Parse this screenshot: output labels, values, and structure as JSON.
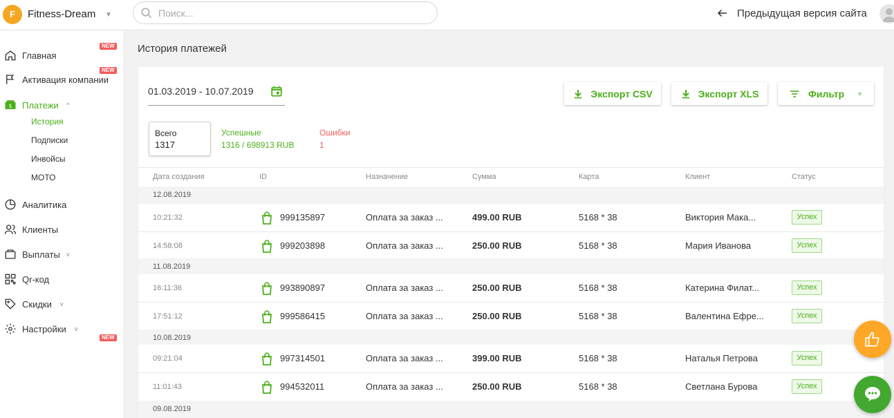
{
  "header": {
    "logo_letter": "F",
    "brand": "Fitness-Dream",
    "search_placeholder": "Поиск...",
    "back_link": "Предыдущая версия сайта"
  },
  "sidebar": {
    "items": [
      {
        "label": "Главная",
        "icon": "home-icon",
        "badge": "NEW"
      },
      {
        "label": "Активация компании",
        "icon": "flag-icon",
        "badge": "NEW"
      },
      {
        "label": "Платежи",
        "icon": "payments-icon",
        "active": true
      },
      {
        "label": "Аналитика",
        "icon": "pie-chart-icon"
      },
      {
        "label": "Клиенты",
        "icon": "users-icon"
      },
      {
        "label": "Выплаты",
        "icon": "wallet-icon"
      },
      {
        "label": "Qr-код",
        "icon": "qr-code-icon"
      },
      {
        "label": "Скидки",
        "icon": "tag-icon"
      },
      {
        "label": "Настройки",
        "icon": "gear-icon",
        "badge": "NEW"
      }
    ],
    "subitems": [
      "История",
      "Подписки",
      "Инвойсы",
      "МОТО"
    ]
  },
  "page": {
    "title": "История платежей",
    "date_range": "01.03.2019 - 10.07.2019",
    "export_csv": "Экспорт CSV",
    "export_xls": "Экспорт XLS",
    "filter": "Фильтр",
    "total_label": "Всего",
    "total_value": "1317",
    "success_label": "Успешные",
    "success_value": "1316 / 698913 RUB",
    "errors_label": "Ошибки",
    "errors_value": "1"
  },
  "table": {
    "columns": [
      "Дата создания",
      "ID",
      "Назначение",
      "Сумма",
      "Карта",
      "Клиент",
      "Статус"
    ],
    "groups": [
      {
        "date": "12.08.2019",
        "rows": [
          {
            "time": "10:21:32",
            "id": "999135897",
            "purpose": "Оплата за заказ ...",
            "sum": "499.00 RUB",
            "card": "5168 * 38",
            "client": "Виктория Мака...",
            "status": "Успех"
          },
          {
            "time": "14:58:08",
            "id": "999203898",
            "purpose": "Оплата за заказ ...",
            "sum": "250.00 RUB",
            "card": "5168 * 38",
            "client": "Мария Иванова",
            "status": "Успех"
          }
        ]
      },
      {
        "date": "11.08.2019",
        "rows": [
          {
            "time": "16:11:36",
            "id": "993890897",
            "purpose": "Оплата за заказ ...",
            "sum": "250.00 RUB",
            "card": "5168 * 38",
            "client": "Катерина Филат...",
            "status": "Успех"
          },
          {
            "time": "17:51:12",
            "id": "999586415",
            "purpose": "Оплата за заказ ...",
            "sum": "250.00 RUB",
            "card": "5168 * 38",
            "client": "Валентина Ефре...",
            "status": "Успех"
          }
        ]
      },
      {
        "date": "10.08.2019",
        "rows": [
          {
            "time": "09:21:04",
            "id": "997314501",
            "purpose": "Оплата за заказ ...",
            "sum": "399.00 RUB",
            "card": "5168 * 38",
            "client": "Наталья Петрова",
            "status": "Успех"
          },
          {
            "time": "11:01:43",
            "id": "994532011",
            "purpose": "Оплата за заказ ...",
            "sum": "250.00 RUB",
            "card": "5168 * 38",
            "client": "Светлана Бурова",
            "status": "Успех"
          }
        ]
      },
      {
        "date": "09.08.2019",
        "rows": []
      }
    ]
  },
  "colors": {
    "accent": "#4caf1a",
    "error": "#f25a5a",
    "logo": "#f5a623",
    "like_fab": "#ffa726",
    "chat_fab": "#43a82f"
  }
}
